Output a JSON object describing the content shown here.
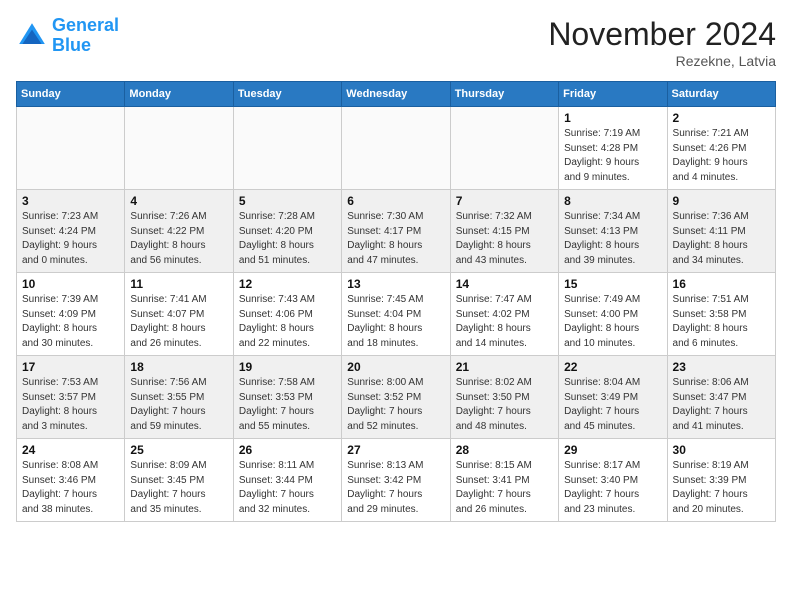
{
  "logo": {
    "line1": "General",
    "line2": "Blue"
  },
  "title": "November 2024",
  "location": "Rezekne, Latvia",
  "weekdays": [
    "Sunday",
    "Monday",
    "Tuesday",
    "Wednesday",
    "Thursday",
    "Friday",
    "Saturday"
  ],
  "weeks": [
    [
      {
        "day": "",
        "info": ""
      },
      {
        "day": "",
        "info": ""
      },
      {
        "day": "",
        "info": ""
      },
      {
        "day": "",
        "info": ""
      },
      {
        "day": "",
        "info": ""
      },
      {
        "day": "1",
        "info": "Sunrise: 7:19 AM\nSunset: 4:28 PM\nDaylight: 9 hours\nand 9 minutes."
      },
      {
        "day": "2",
        "info": "Sunrise: 7:21 AM\nSunset: 4:26 PM\nDaylight: 9 hours\nand 4 minutes."
      }
    ],
    [
      {
        "day": "3",
        "info": "Sunrise: 7:23 AM\nSunset: 4:24 PM\nDaylight: 9 hours\nand 0 minutes."
      },
      {
        "day": "4",
        "info": "Sunrise: 7:26 AM\nSunset: 4:22 PM\nDaylight: 8 hours\nand 56 minutes."
      },
      {
        "day": "5",
        "info": "Sunrise: 7:28 AM\nSunset: 4:20 PM\nDaylight: 8 hours\nand 51 minutes."
      },
      {
        "day": "6",
        "info": "Sunrise: 7:30 AM\nSunset: 4:17 PM\nDaylight: 8 hours\nand 47 minutes."
      },
      {
        "day": "7",
        "info": "Sunrise: 7:32 AM\nSunset: 4:15 PM\nDaylight: 8 hours\nand 43 minutes."
      },
      {
        "day": "8",
        "info": "Sunrise: 7:34 AM\nSunset: 4:13 PM\nDaylight: 8 hours\nand 39 minutes."
      },
      {
        "day": "9",
        "info": "Sunrise: 7:36 AM\nSunset: 4:11 PM\nDaylight: 8 hours\nand 34 minutes."
      }
    ],
    [
      {
        "day": "10",
        "info": "Sunrise: 7:39 AM\nSunset: 4:09 PM\nDaylight: 8 hours\nand 30 minutes."
      },
      {
        "day": "11",
        "info": "Sunrise: 7:41 AM\nSunset: 4:07 PM\nDaylight: 8 hours\nand 26 minutes."
      },
      {
        "day": "12",
        "info": "Sunrise: 7:43 AM\nSunset: 4:06 PM\nDaylight: 8 hours\nand 22 minutes."
      },
      {
        "day": "13",
        "info": "Sunrise: 7:45 AM\nSunset: 4:04 PM\nDaylight: 8 hours\nand 18 minutes."
      },
      {
        "day": "14",
        "info": "Sunrise: 7:47 AM\nSunset: 4:02 PM\nDaylight: 8 hours\nand 14 minutes."
      },
      {
        "day": "15",
        "info": "Sunrise: 7:49 AM\nSunset: 4:00 PM\nDaylight: 8 hours\nand 10 minutes."
      },
      {
        "day": "16",
        "info": "Sunrise: 7:51 AM\nSunset: 3:58 PM\nDaylight: 8 hours\nand 6 minutes."
      }
    ],
    [
      {
        "day": "17",
        "info": "Sunrise: 7:53 AM\nSunset: 3:57 PM\nDaylight: 8 hours\nand 3 minutes."
      },
      {
        "day": "18",
        "info": "Sunrise: 7:56 AM\nSunset: 3:55 PM\nDaylight: 7 hours\nand 59 minutes."
      },
      {
        "day": "19",
        "info": "Sunrise: 7:58 AM\nSunset: 3:53 PM\nDaylight: 7 hours\nand 55 minutes."
      },
      {
        "day": "20",
        "info": "Sunrise: 8:00 AM\nSunset: 3:52 PM\nDaylight: 7 hours\nand 52 minutes."
      },
      {
        "day": "21",
        "info": "Sunrise: 8:02 AM\nSunset: 3:50 PM\nDaylight: 7 hours\nand 48 minutes."
      },
      {
        "day": "22",
        "info": "Sunrise: 8:04 AM\nSunset: 3:49 PM\nDaylight: 7 hours\nand 45 minutes."
      },
      {
        "day": "23",
        "info": "Sunrise: 8:06 AM\nSunset: 3:47 PM\nDaylight: 7 hours\nand 41 minutes."
      }
    ],
    [
      {
        "day": "24",
        "info": "Sunrise: 8:08 AM\nSunset: 3:46 PM\nDaylight: 7 hours\nand 38 minutes."
      },
      {
        "day": "25",
        "info": "Sunrise: 8:09 AM\nSunset: 3:45 PM\nDaylight: 7 hours\nand 35 minutes."
      },
      {
        "day": "26",
        "info": "Sunrise: 8:11 AM\nSunset: 3:44 PM\nDaylight: 7 hours\nand 32 minutes."
      },
      {
        "day": "27",
        "info": "Sunrise: 8:13 AM\nSunset: 3:42 PM\nDaylight: 7 hours\nand 29 minutes."
      },
      {
        "day": "28",
        "info": "Sunrise: 8:15 AM\nSunset: 3:41 PM\nDaylight: 7 hours\nand 26 minutes."
      },
      {
        "day": "29",
        "info": "Sunrise: 8:17 AM\nSunset: 3:40 PM\nDaylight: 7 hours\nand 23 minutes."
      },
      {
        "day": "30",
        "info": "Sunrise: 8:19 AM\nSunset: 3:39 PM\nDaylight: 7 hours\nand 20 minutes."
      }
    ]
  ]
}
